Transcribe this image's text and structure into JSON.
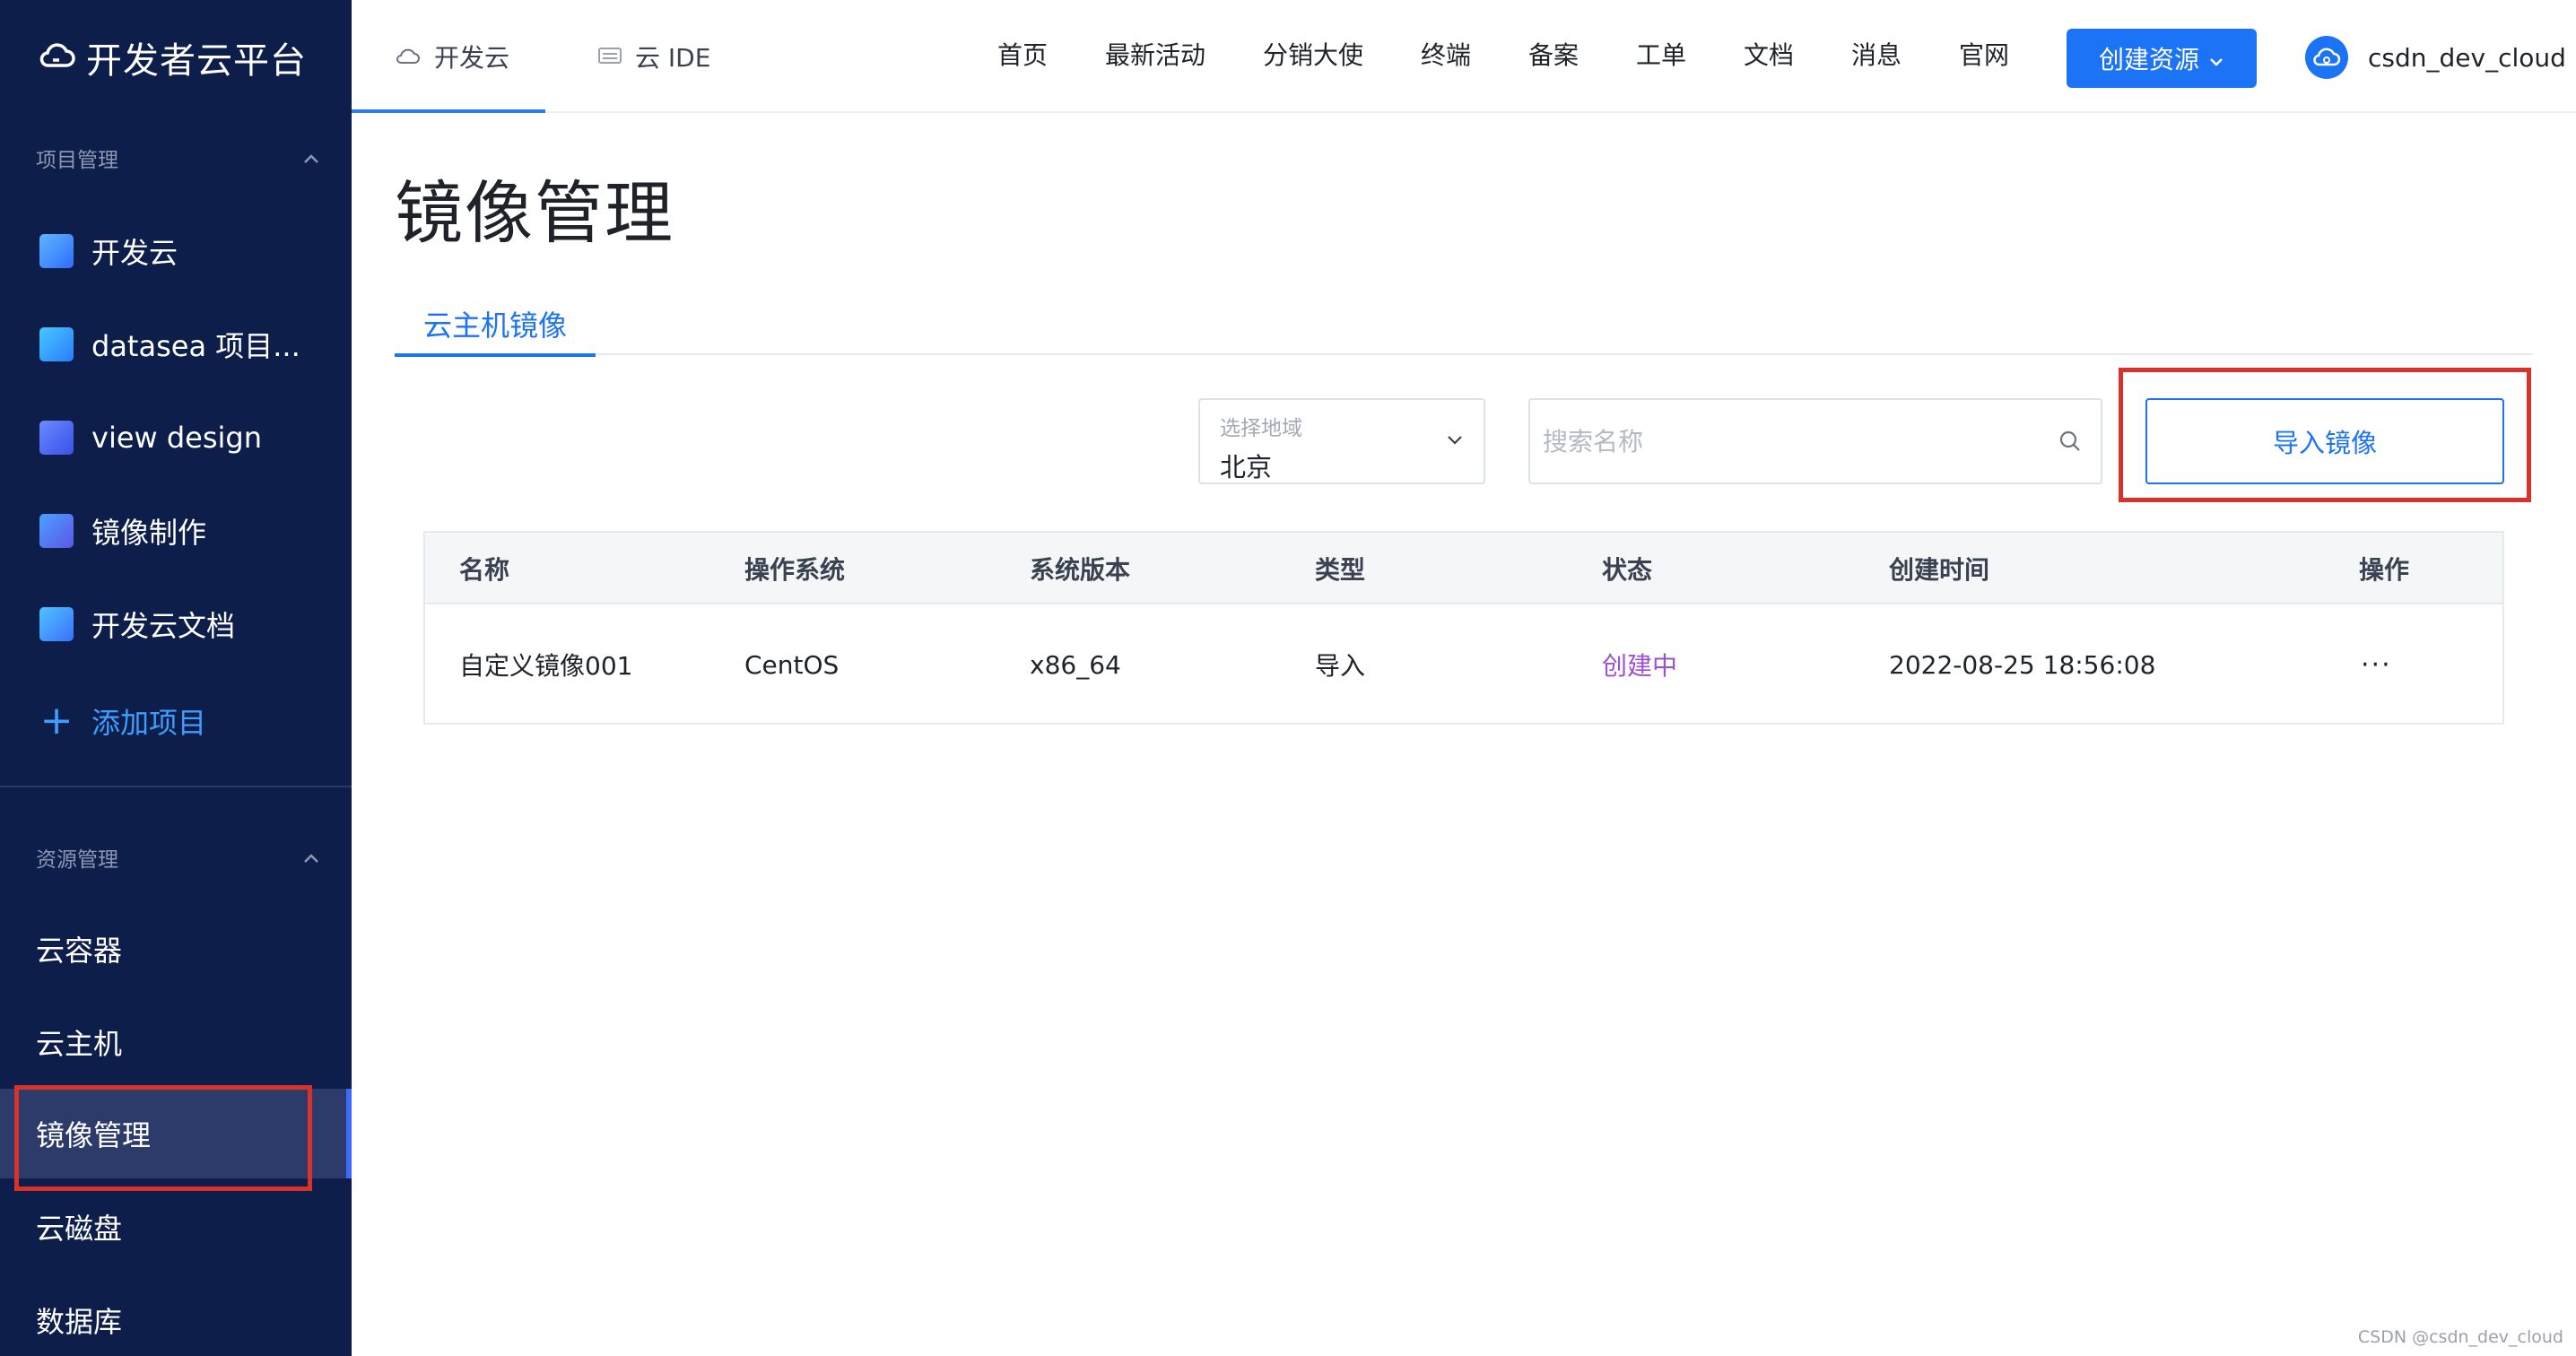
{
  "app": {
    "title": "开发者云平台"
  },
  "sidebar": {
    "project_section": "项目管理",
    "projects": [
      {
        "label": "开发云",
        "icon": "project-kaifayun-icon",
        "color": "#3a8bff"
      },
      {
        "label": "datasea 项目...",
        "icon": "project-datasea-icon",
        "color": "#2ba6ff"
      },
      {
        "label": "view design",
        "icon": "project-view-design-icon",
        "color": "#4a6cff"
      },
      {
        "label": "镜像制作",
        "icon": "project-image-make-icon",
        "color": "#3f7cff"
      },
      {
        "label": "开发云文档",
        "icon": "project-docs-icon",
        "color": "#3a96ff"
      }
    ],
    "add_project": "添加项目",
    "resource_section": "资源管理",
    "resources": [
      {
        "label": "云容器"
      },
      {
        "label": "云主机"
      },
      {
        "label": "镜像管理"
      },
      {
        "label": "云磁盘"
      },
      {
        "label": "数据库"
      }
    ]
  },
  "topbar": {
    "tabs": [
      {
        "label": "开发云"
      },
      {
        "label": "云 IDE"
      }
    ],
    "nav": [
      {
        "label": "首页"
      },
      {
        "label": "最新活动"
      },
      {
        "label": "分销大使"
      },
      {
        "label": "终端"
      },
      {
        "label": "备案"
      },
      {
        "label": "工单"
      },
      {
        "label": "文档"
      },
      {
        "label": "消息"
      },
      {
        "label": "官网"
      }
    ],
    "create_label": "创建资源",
    "username": "csdn_dev_cloud"
  },
  "main": {
    "title": "镜像管理",
    "tab": "云主机镜像",
    "region": {
      "label": "选择地域",
      "value": "北京"
    },
    "search": {
      "placeholder": "搜索名称"
    },
    "import_label": "导入镜像",
    "table": {
      "headers": [
        "名称",
        "操作系统",
        "系统版本",
        "类型",
        "状态",
        "创建时间",
        "操作"
      ],
      "rows": [
        {
          "name": "自定义镜像001",
          "os": "CentOS",
          "version": "x86_64",
          "type": "导入",
          "status": "创建中",
          "created": "2022-08-25 18:56:08",
          "action": "···"
        }
      ]
    },
    "status_color": "#9c4fd0"
  },
  "watermark": "CSDN @csdn_dev_cloud",
  "colors": {
    "sidebar_bg": "#0e1e4a",
    "accent": "#1d73f5",
    "highlight_box": "#d9322b"
  }
}
